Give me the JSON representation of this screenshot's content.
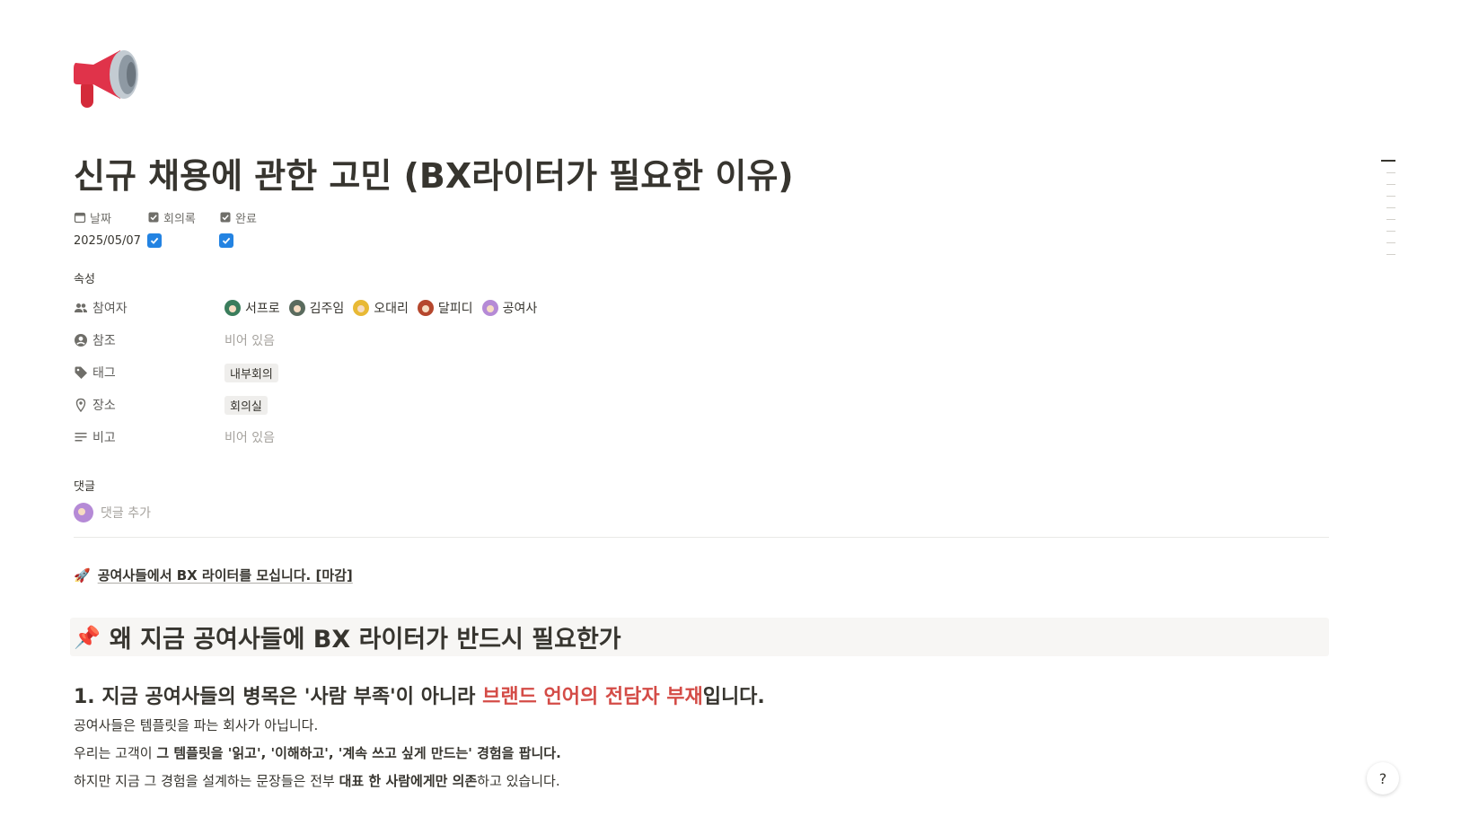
{
  "page": {
    "icon": "megaphone-icon",
    "title": "신규 채용에 관한 고민 (BX라이터가 필요한 이유)"
  },
  "top_props": [
    {
      "label": "날짜",
      "icon": "calendar-icon",
      "value": "2025/05/07"
    },
    {
      "label": "회의록",
      "icon": "checkbox-icon",
      "checked": true
    },
    {
      "label": "완료",
      "icon": "checkbox-icon",
      "checked": true
    }
  ],
  "properties": {
    "section_label": "속성",
    "participants": {
      "label": "참여자",
      "people": [
        {
          "name": "서프로",
          "color": "#3a7d5c"
        },
        {
          "name": "김주임",
          "color": "#5a6b5e"
        },
        {
          "name": "오대리",
          "color": "#e8b935"
        },
        {
          "name": "달피디",
          "color": "#b5472d"
        },
        {
          "name": "공여사",
          "color": "#b58ad6"
        }
      ]
    },
    "reference": {
      "label": "참조",
      "value": "비어 있음"
    },
    "tags": {
      "label": "태그",
      "value": "내부회의"
    },
    "place": {
      "label": "장소",
      "value": "회의실"
    },
    "note": {
      "label": "비고",
      "value": "비어 있음"
    }
  },
  "comments": {
    "label": "댓글",
    "placeholder": "댓글 추가",
    "avatar_color": "#b58ad6"
  },
  "content": {
    "notice": {
      "icon": "rocket-icon",
      "text": "공여사들에서 BX 라이터를 모십니다. [마감]"
    },
    "callout": {
      "icon": "pushpin-icon",
      "text": "왜 지금 공여사들에 BX 라이터가 반드시 필요한가"
    },
    "heading": {
      "prefix": "1. 지금 공여사들의 병목은 '사람 부족'이 아니라 ",
      "highlight": "브랜드 언어의 전담자 부재",
      "suffix": "입니다."
    },
    "para1": "공여사들은 템플릿을 파는 회사가 아닙니다.",
    "para2": {
      "a": "우리는 고객이 ",
      "b": "그 템플릿을 '읽고', '이해하고', '계속 쓰고 싶게 만드는' 경험을 팝니다."
    },
    "para3": {
      "a": "하지만 지금 그 경험을 설계하는 문장들은 전부 ",
      "b": "대표 한 사람에게만 의존",
      "c": "하고 있습니다."
    }
  },
  "help": {
    "label": "?"
  }
}
